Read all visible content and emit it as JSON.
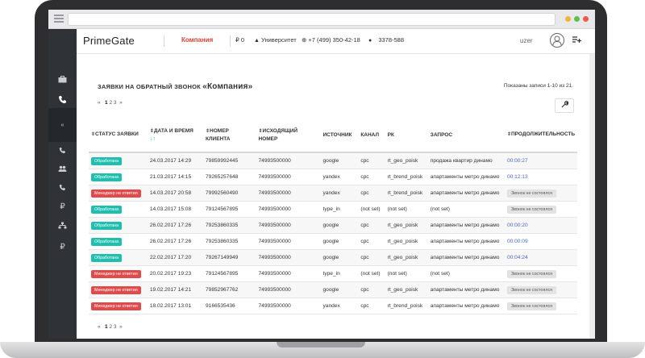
{
  "app": {
    "brand": "PrimeGate"
  },
  "topbar": {
    "company": "Компания",
    "balance": "₽ 0",
    "university": "Университет",
    "phone": "+7 (499) 350-42-18",
    "account": "3378-588",
    "user": "uzer"
  },
  "page": {
    "title_prefix": "ЗАЯВКИ НА ОБРАТНЫЙ ЗВОНОК",
    "title_company": "«Компания»",
    "shown_text": "Показаны записи 1-10 из 21."
  },
  "pager": {
    "prev": "«",
    "pages": [
      "1",
      "2",
      "3"
    ],
    "next": "»"
  },
  "table": {
    "headers": {
      "status": "СТАТУС ЗАЯВКИ",
      "datetime": "ДАТА И ВРЕМЯ",
      "client_number": "НОМЕР КЛИЕНТА",
      "outgoing_number": "ИСХОДЯЩИЙ НОМЕР",
      "source": "ИСТОЧНИК",
      "channel": "КАНАЛ",
      "rk": "РК",
      "query": "ЗАПРОС",
      "duration": "ПРОДОЛЖИТЕЛЬНОСТЬ"
    },
    "rows": [
      {
        "status": "Обработана",
        "datetime": "24.03.2017 14:29",
        "client": "79859992445",
        "outgoing": "74993500000",
        "source": "google",
        "channel": "cpc",
        "rk": "rt_geo_poisk",
        "query": "продажа квартир динамо",
        "duration": "00:00:27"
      },
      {
        "status": "Обработана",
        "datetime": "21.03.2017 14:15",
        "client": "79265257648",
        "outgoing": "74993500000",
        "source": "yandex",
        "channel": "cpc",
        "rk": "rt_brend_poisk",
        "query": "апартаменты метро динамо",
        "duration": "00:12:13"
      },
      {
        "status": "Менеджер не ответил",
        "datetime": "14.03.2017 20:58",
        "client": "79992560490",
        "outgoing": "74993500000",
        "source": "yandex",
        "channel": "cpc",
        "rk": "rt_brend_poisk",
        "query": "апартаменты метро динамо",
        "duration": "Звонок не состоялся"
      },
      {
        "status": "Обработана",
        "datetime": "14.03.2017 15:08",
        "client": "79124567895",
        "outgoing": "74993500000",
        "source": "type_in",
        "channel": "(not set)",
        "rk": "(not set)",
        "query": "(not set)",
        "duration": "Звонок не состоялся"
      },
      {
        "status": "Обработана",
        "datetime": "26.02.2017 17:26",
        "client": "79253860335",
        "outgoing": "74993500000",
        "source": "google",
        "channel": "cpc",
        "rk": "rt_geo_poisk",
        "query": "апартаменты метро динамо",
        "duration": "00:00:20"
      },
      {
        "status": "Обработана",
        "datetime": "26.02.2017 17:26",
        "client": "79253860335",
        "outgoing": "74993500000",
        "source": "google",
        "channel": "cpc",
        "rk": "rt_geo_poisk",
        "query": "апартаменты метро динамо",
        "duration": "00:00:09"
      },
      {
        "status": "Обработана",
        "datetime": "22.02.2017 17:20",
        "client": "79267149949",
        "outgoing": "74993500000",
        "source": "google",
        "channel": "cpc",
        "rk": "rt_geo_poisk",
        "query": "апартаменты метро динамо",
        "duration": "00:04:24"
      },
      {
        "status": "Менеджер не ответил",
        "datetime": "20.02.2017 19:23",
        "client": "79124567895",
        "outgoing": "74993500000",
        "source": "type_in",
        "channel": "(not set)",
        "rk": "(not set)",
        "query": "(not set)",
        "duration": "Звонок не состоялся"
      },
      {
        "status": "Менеджер не ответил",
        "datetime": "19.02.2017 14:21",
        "client": "79852967762",
        "outgoing": "74993500000",
        "source": "google",
        "channel": "cpc",
        "rk": "rt_geo_poisk",
        "query": "апартаменты метро динамо",
        "duration": "Звонок не состоялся"
      },
      {
        "status": "Менеджер не ответил",
        "datetime": "18.02.2017 13:01",
        "client": "9166535436",
        "outgoing": "74993500000",
        "source": "yandex",
        "channel": "cpc",
        "rk": "rt_brend_poisk",
        "query": "апартаменты метро динамо",
        "duration": "Звонок не состоялся"
      }
    ]
  },
  "icons": {
    "sidebar": [
      "home-icon",
      "phone-icon",
      "collapse-icon",
      "callback-icon",
      "users-icon",
      "call-icon",
      "ruble-icon",
      "sitemap-icon",
      "ruble-icon"
    ],
    "wrench": "wrench-icon"
  },
  "colors": {
    "accent_red": "#d9433b",
    "badge_green": "#1fbfaf",
    "badge_red": "#e04a4a",
    "link_blue": "#4a66b8"
  }
}
